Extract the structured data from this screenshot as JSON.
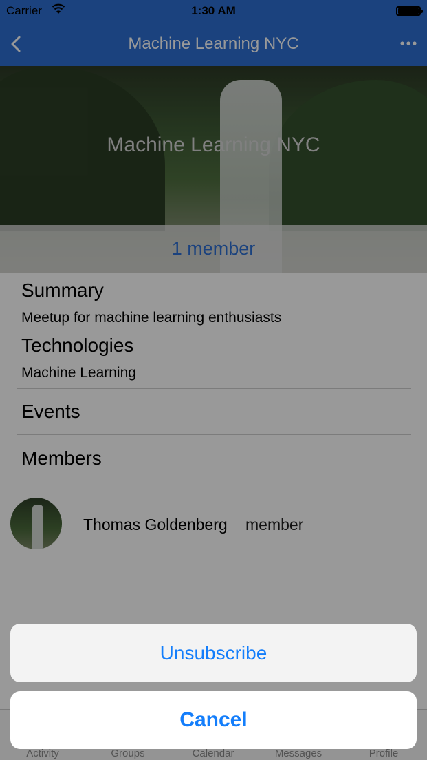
{
  "status_bar": {
    "carrier": "Carrier",
    "time": "1:30 AM"
  },
  "nav": {
    "title": "Machine Learning NYC"
  },
  "hero": {
    "title": "Machine Learning NYC",
    "member_count": "1 member"
  },
  "summary": {
    "heading": "Summary",
    "text": "Meetup for machine learning enthusiasts"
  },
  "technologies": {
    "heading": "Technologies",
    "text": "Machine Learning"
  },
  "rows": {
    "events": "Events",
    "members": "Members"
  },
  "members": [
    {
      "name": "Thomas Goldenberg",
      "role": "member"
    }
  ],
  "tabs": [
    "Activity",
    "Groups",
    "Calendar",
    "Messages",
    "Profile"
  ],
  "action_sheet": {
    "unsubscribe": "Unsubscribe",
    "cancel": "Cancel"
  },
  "colors": {
    "nav_blue": "#2d6fd2",
    "action_blue": "#147efb"
  }
}
